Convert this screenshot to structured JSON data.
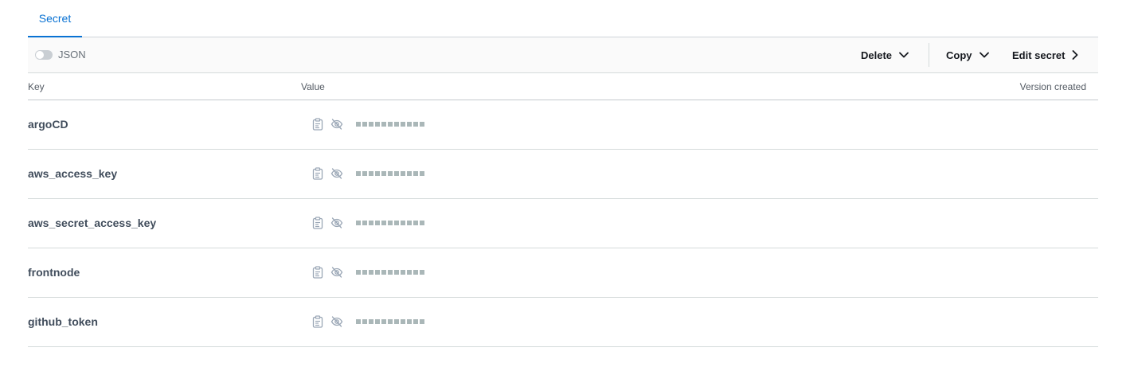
{
  "tabs": [
    {
      "label": "Secret",
      "active": true
    }
  ],
  "toolbar": {
    "json_toggle_label": "JSON",
    "json_toggle_on": false,
    "delete_label": "Delete",
    "copy_label": "Copy",
    "edit_label": "Edit secret"
  },
  "table": {
    "columns": [
      "Key",
      "Value",
      "Version created"
    ],
    "rows": [
      {
        "key": "argoCD",
        "value_masked": true,
        "version_created": ""
      },
      {
        "key": "aws_access_key",
        "value_masked": true,
        "version_created": ""
      },
      {
        "key": "aws_secret_access_key",
        "value_masked": true,
        "version_created": ""
      },
      {
        "key": "frontnode",
        "value_masked": true,
        "version_created": ""
      },
      {
        "key": "github_token",
        "value_masked": true,
        "version_created": ""
      }
    ]
  },
  "icons": {
    "row_copy": "clipboard-icon",
    "row_reveal": "eye-off-icon",
    "delete_caret": "chevron-down-icon",
    "copy_caret": "chevron-down-icon",
    "edit_arrow": "chevron-right-icon"
  },
  "colors": {
    "accent": "#0972d3",
    "mask": "#aab7b8",
    "icon": "#9ba7b6"
  }
}
